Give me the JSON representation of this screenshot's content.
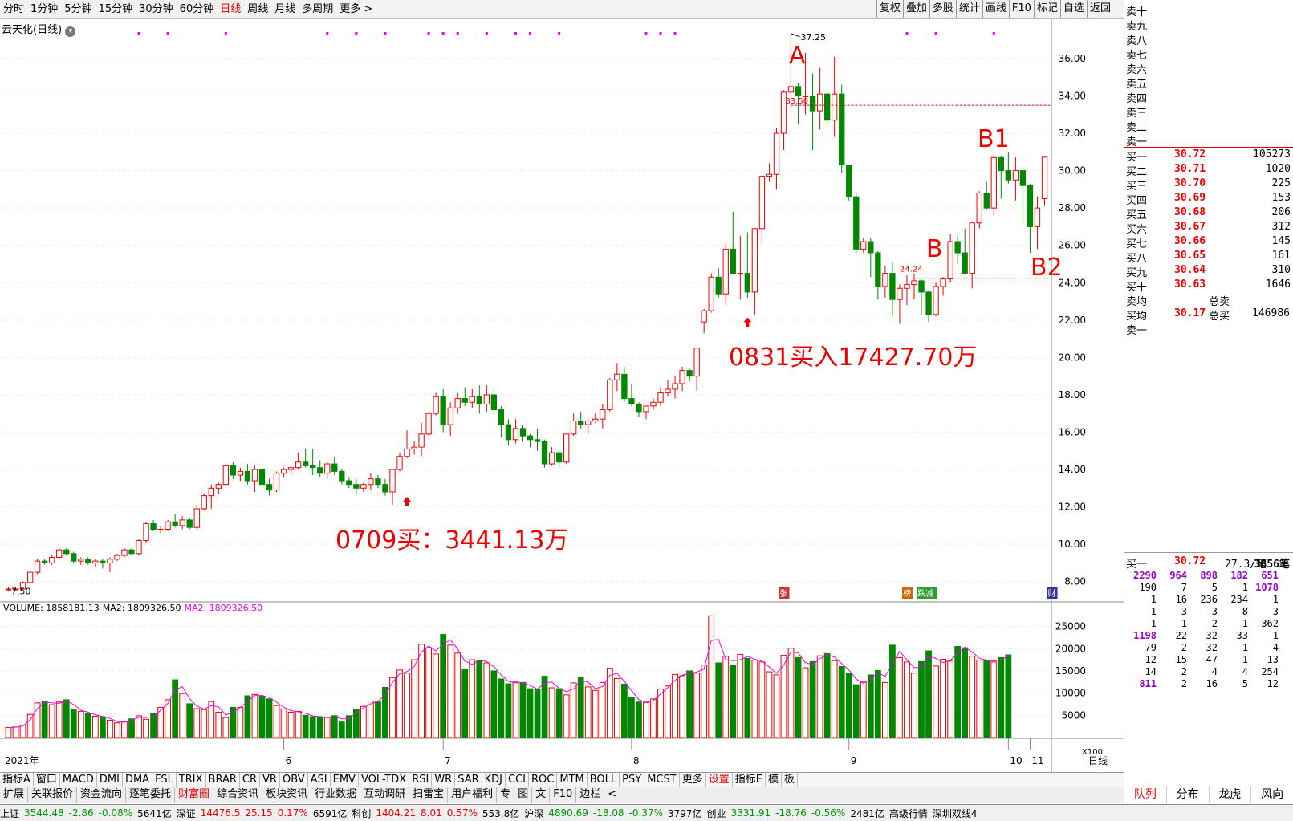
{
  "toolbar": {
    "left": [
      "分时",
      "1分钟",
      "5分钟",
      "15分钟",
      "30分钟",
      "60分钟",
      "日线",
      "周线",
      "月线",
      "多周期",
      "更多 >"
    ],
    "active_index": 6,
    "right": [
      "复权",
      "叠加",
      "多股",
      "统计",
      "画线",
      "F10",
      "标记",
      "自选",
      "返回"
    ]
  },
  "stock_title": "云天化(日线)",
  "annotations": {
    "a": "A",
    "b": "B",
    "b1": "B1",
    "b2": "B2",
    "buy1": "0709买：3441.13万",
    "buy2": "0831买入17427.70万",
    "high": "37.25",
    "low": "7.50",
    "line1": "33.50",
    "line2": "24.24"
  },
  "event_tags": [
    "张",
    "榜",
    "跌减",
    "财"
  ],
  "volume_header": {
    "volume": "VOLUME: 1858181.13",
    "ma2": "MA2: 1809326.50",
    "ma2b": "MA2: 1809326.50"
  },
  "x_labels": [
    "2021年",
    "6",
    "7",
    "8",
    "9",
    "10",
    "11"
  ],
  "period_label": "日线",
  "vol_scale": "X100",
  "sell_levels": [
    "卖十",
    "卖九",
    "卖八",
    "卖七",
    "卖六",
    "卖五",
    "卖四",
    "卖三",
    "卖二",
    "卖一"
  ],
  "buy_levels": [
    {
      "label": "买一",
      "price": "30.72",
      "vol": "105273"
    },
    {
      "label": "买二",
      "price": "30.71",
      "vol": "1020"
    },
    {
      "label": "买三",
      "price": "30.70",
      "vol": "225"
    },
    {
      "label": "买四",
      "price": "30.69",
      "vol": "153"
    },
    {
      "label": "买五",
      "price": "30.68",
      "vol": "206"
    },
    {
      "label": "买六",
      "price": "30.67",
      "vol": "312"
    },
    {
      "label": "买七",
      "price": "30.66",
      "vol": "145"
    },
    {
      "label": "买八",
      "price": "30.65",
      "vol": "161"
    },
    {
      "label": "买九",
      "price": "30.64",
      "vol": "310"
    },
    {
      "label": "买十",
      "price": "30.63",
      "vol": "1646"
    }
  ],
  "averages": {
    "sell_avg": "卖均",
    "total_sell": "总卖",
    "buy_avg": "买均",
    "buy_avg_price": "30.17",
    "total_buy": "总买",
    "total_buy_vol": "146986",
    "sell1": "卖一"
  },
  "queue": {
    "label": "买一",
    "price": "30.72",
    "per": "27.3/笔",
    "count": "3856笔",
    "rows": [
      [
        "2290",
        "964",
        "898",
        "182",
        "651"
      ],
      [
        "190",
        "7",
        "5",
        "1",
        "1078"
      ],
      [
        "1",
        "16",
        "236",
        "234",
        "1"
      ],
      [
        "1",
        "3",
        "3",
        "8",
        "3"
      ],
      [
        "1",
        "1",
        "2",
        "1",
        "362"
      ],
      [
        "1198",
        "22",
        "32",
        "33",
        "1"
      ],
      [
        "79",
        "2",
        "32",
        "1",
        "4"
      ],
      [
        "12",
        "15",
        "47",
        "1",
        "13"
      ],
      [
        "14",
        "2",
        "4",
        "4",
        "254"
      ],
      [
        "811",
        "2",
        "16",
        "5",
        "12"
      ]
    ]
  },
  "bottom_tabs1": [
    "指标A",
    "窗口",
    "MACD",
    "DMI",
    "DMA",
    "FSL",
    "TRIX",
    "BRAR",
    "CR",
    "VR",
    "OBV",
    "ASI",
    "EMV",
    "VOL-TDX",
    "RSI",
    "WR",
    "SAR",
    "KDJ",
    "CCI",
    "ROC",
    "MTM",
    "BOLL",
    "PSY",
    "MCST",
    "更多",
    "设置",
    "指标E",
    "模",
    "板"
  ],
  "bottom_tabs2": [
    "扩展",
    "关联报价",
    "资金流向",
    "逐笔委托",
    "财富圈",
    "综合资讯",
    "板块资讯",
    "行业数据",
    "互动调研",
    "扫雷宝",
    "用户福利",
    "专",
    "图",
    "文",
    "F10",
    "边栏",
    "<"
  ],
  "side_tabs": [
    "队列",
    "分布",
    "龙虎",
    "风向"
  ],
  "status": [
    {
      "name": "上证",
      "v": "3544.48",
      "c": "-2.86",
      "p": "-0.08%",
      "a": "5641亿"
    },
    {
      "name": "深证",
      "v": "14476.5",
      "c": "25.15",
      "p": "0.17%",
      "a": "6591亿"
    },
    {
      "name": "科创",
      "v": "1404.21",
      "c": "8.01",
      "p": "0.57%",
      "a": "553.8亿"
    },
    {
      "name": "沪深",
      "v": "4890.69",
      "c": "-18.08",
      "p": "-0.37%",
      "a": "3797亿"
    },
    {
      "name": "创业",
      "v": "3331.91",
      "c": "-18.76",
      "p": "-0.56%",
      "a": "2481亿"
    }
  ],
  "status_extra": [
    "高级行情",
    "深圳双线4"
  ],
  "chart_data": {
    "type": "candlestick",
    "y_ticks": [
      8,
      10,
      12,
      14,
      16,
      18,
      20,
      22,
      24,
      26,
      28,
      30,
      32,
      34,
      36
    ],
    "ylim": [
      7,
      37.5
    ],
    "vol_ticks": [
      5000,
      10000,
      15000,
      20000,
      25000
    ],
    "vol_lim": [
      0,
      28000
    ],
    "candles": [
      [
        7.6,
        7.7,
        7.5,
        7.6
      ],
      [
        7.6,
        7.7,
        7.55,
        7.6
      ],
      [
        7.6,
        8,
        7.55,
        7.95
      ],
      [
        7.95,
        8.6,
        7.9,
        8.5
      ],
      [
        8.5,
        9.2,
        8.4,
        9.1
      ],
      [
        9.1,
        9.2,
        8.9,
        9
      ],
      [
        9,
        9.4,
        8.9,
        9.3
      ],
      [
        9.3,
        9.8,
        9.2,
        9.7
      ],
      [
        9.7,
        9.8,
        9.4,
        9.5
      ],
      [
        9.5,
        9.6,
        9,
        9.1
      ],
      [
        9.1,
        9.3,
        8.9,
        9.2
      ],
      [
        9.2,
        9.3,
        8.9,
        9
      ],
      [
        9,
        9.2,
        8.8,
        9.1
      ],
      [
        9.1,
        9.2,
        8.7,
        9
      ],
      [
        9,
        9.3,
        8.5,
        9.2
      ],
      [
        9.2,
        9.5,
        9.1,
        9.4
      ],
      [
        9.4,
        9.8,
        9.3,
        9.7
      ],
      [
        9.7,
        9.8,
        9.4,
        9.5
      ],
      [
        9.5,
        10.3,
        9.4,
        10.2
      ],
      [
        10.2,
        11.2,
        10.1,
        11.1
      ],
      [
        11.1,
        11.3,
        10.7,
        10.8
      ],
      [
        10.8,
        11,
        10.6,
        10.8
      ],
      [
        10.8,
        11.3,
        10.7,
        11.2
      ],
      [
        11.2,
        11.6,
        10.9,
        11
      ],
      [
        11,
        11.5,
        10.8,
        11.3
      ],
      [
        11.3,
        11.4,
        10.8,
        10.9
      ],
      [
        10.9,
        12.1,
        10.8,
        11.9
      ],
      [
        11.9,
        12.7,
        11.8,
        12.6
      ],
      [
        12.6,
        13.2,
        11.9,
        13
      ],
      [
        13,
        13.3,
        12.7,
        13.2
      ],
      [
        13.2,
        14.2,
        13.1,
        14.2
      ],
      [
        14.2,
        14.4,
        13.5,
        13.7
      ],
      [
        13.7,
        14.1,
        13.4,
        13.9
      ],
      [
        13.9,
        14.3,
        13.2,
        13.4
      ],
      [
        13.4,
        14.2,
        12.8,
        14
      ],
      [
        14,
        14.1,
        12.9,
        13.2
      ],
      [
        13.2,
        13.5,
        12.6,
        12.9
      ],
      [
        12.9,
        13.9,
        12.8,
        13.8
      ],
      [
        13.8,
        14.1,
        13.6,
        14
      ],
      [
        14,
        14.2,
        13.7,
        14.1
      ],
      [
        14.1,
        14.9,
        14,
        14.4
      ],
      [
        14.4,
        15.1,
        14.1,
        14.2
      ],
      [
        14.2,
        15.1,
        13.7,
        14.1
      ],
      [
        14.1,
        14.5,
        13.6,
        13.8
      ],
      [
        13.8,
        14.4,
        13.5,
        14.3
      ],
      [
        14.3,
        14.7,
        13.7,
        13.9
      ],
      [
        13.9,
        14,
        13.2,
        13.4
      ],
      [
        13.4,
        13.6,
        13,
        13.2
      ],
      [
        13.2,
        13.5,
        12.7,
        13
      ],
      [
        13,
        13.3,
        12.8,
        13.2
      ],
      [
        13.2,
        13.8,
        12.9,
        13.5
      ],
      [
        13.5,
        13.7,
        13,
        13.2
      ],
      [
        13.2,
        13.5,
        12.6,
        12.8
      ],
      [
        12.8,
        14,
        12.1,
        14
      ],
      [
        14,
        14.9,
        13.9,
        14.7
      ],
      [
        14.7,
        16.1,
        14.6,
        15.1
      ],
      [
        15.1,
        15.5,
        14.8,
        15.2
      ],
      [
        15.2,
        16.5,
        14.7,
        15.9
      ],
      [
        15.9,
        17.1,
        15.8,
        17
      ],
      [
        17,
        18.1,
        16.9,
        17.9
      ],
      [
        17.9,
        18.3,
        16,
        16.4
      ],
      [
        16.4,
        17.6,
        15.8,
        17.3
      ],
      [
        17.3,
        18.1,
        17,
        17.8
      ],
      [
        17.8,
        18.4,
        17.4,
        17.6
      ],
      [
        17.6,
        18.3,
        17.3,
        17.9
      ],
      [
        17.9,
        18.5,
        17,
        17.5
      ],
      [
        17.5,
        18.5,
        17.1,
        18
      ],
      [
        18,
        18.3,
        16.9,
        17.2
      ],
      [
        17.2,
        17.4,
        15.7,
        16.4
      ],
      [
        16.4,
        16.7,
        15.3,
        15.6
      ],
      [
        15.6,
        16.7,
        15.4,
        16.2
      ],
      [
        16.2,
        16.4,
        15.5,
        15.8
      ],
      [
        15.8,
        15.9,
        15.2,
        15.6
      ],
      [
        15.6,
        16.2,
        15,
        15.5
      ],
      [
        15.5,
        15.6,
        14.1,
        14.3
      ],
      [
        14.3,
        15.2,
        14.2,
        14.9
      ],
      [
        14.9,
        15,
        14.1,
        14.4
      ],
      [
        14.4,
        15.6,
        14.3,
        15.9
      ],
      [
        15.9,
        17,
        15.8,
        16.6
      ],
      [
        16.6,
        17.1,
        16.2,
        16.4
      ],
      [
        16.4,
        16.7,
        15.9,
        16.6
      ],
      [
        16.6,
        17,
        16.5,
        16.7
      ],
      [
        16.7,
        17.5,
        16.2,
        17.2
      ],
      [
        17.2,
        18.9,
        17.1,
        18.8
      ],
      [
        18.8,
        19.7,
        18.2,
        19.1
      ],
      [
        19.1,
        19.5,
        17.6,
        17.8
      ],
      [
        17.8,
        18.6,
        17.4,
        17.5
      ],
      [
        17.5,
        17.6,
        16.8,
        17.1
      ],
      [
        17.1,
        17.3,
        16.7,
        17.4
      ],
      [
        17.4,
        17.8,
        17.2,
        17.6
      ],
      [
        17.6,
        18.4,
        17.4,
        18.1
      ],
      [
        18.1,
        18.8,
        17.9,
        18.3
      ],
      [
        18.3,
        19,
        17.8,
        18.6
      ],
      [
        18.6,
        19.5,
        18.2,
        19.3
      ],
      [
        19.3,
        19.4,
        18.7,
        19
      ],
      [
        19,
        20.5,
        18.2,
        20.5
      ],
      [
        21.9,
        22.6,
        21.3,
        22.5
      ],
      [
        22.5,
        24.5,
        22.4,
        24.3
      ],
      [
        24.3,
        24.8,
        23.2,
        23.4
      ],
      [
        23.4,
        26.1,
        22.8,
        25.8
      ],
      [
        25.8,
        27.8,
        25.7,
        24.5
      ],
      [
        24.5,
        26.5,
        23.1,
        24.5
      ],
      [
        24.5,
        26.7,
        23.2,
        23.5
      ],
      [
        23.5,
        26.9,
        22.3,
        26.9
      ],
      [
        26.9,
        29.8,
        26.1,
        29.7
      ],
      [
        29.7,
        30.4,
        29.4,
        29.8
      ],
      [
        29.8,
        32.3,
        29,
        32
      ],
      [
        32,
        34.3,
        31.1,
        34.2
      ],
      [
        34.2,
        37.25,
        33.2,
        34.5
      ],
      [
        34.5,
        34.7,
        32.5,
        34
      ],
      [
        34,
        36.3,
        33,
        34
      ],
      [
        34,
        35.2,
        31.1,
        33.2
      ],
      [
        33.2,
        35.5,
        32.2,
        34.1
      ],
      [
        34.1,
        34.2,
        32.5,
        32.7
      ],
      [
        32.7,
        36.1,
        31.8,
        34.1
      ],
      [
        34.1,
        34.6,
        29.9,
        30.3
      ],
      [
        30.3,
        30.3,
        28.4,
        28.6
      ],
      [
        28.6,
        28.8,
        25.6,
        25.8
      ],
      [
        25.8,
        26.4,
        25.6,
        26.2
      ],
      [
        26.2,
        26.4,
        24.3,
        25.6
      ],
      [
        25.6,
        25.7,
        23.1,
        23.8
      ],
      [
        23.8,
        24.9,
        23.2,
        24.5
      ],
      [
        24.5,
        25.1,
        22.2,
        23.1
      ],
      [
        23.1,
        23.9,
        21.8,
        23.7
      ],
      [
        23.7,
        24.4,
        22.8,
        23.9
      ],
      [
        23.9,
        24.5,
        23.1,
        24.1
      ],
      [
        24.1,
        24.2,
        22.3,
        23.5
      ],
      [
        23.5,
        23.6,
        21.9,
        22.3
      ],
      [
        22.3,
        24,
        22.2,
        23.8
      ],
      [
        23.8,
        24.3,
        23.3,
        24.2
      ],
      [
        24.2,
        26.6,
        24,
        26.2
      ],
      [
        26.2,
        26.5,
        25,
        25.6
      ],
      [
        25.6,
        26.9,
        24.8,
        24.5
      ],
      [
        24.5,
        27.2,
        23.7,
        27.2
      ],
      [
        27.2,
        28.9,
        26.9,
        28.8
      ],
      [
        28.8,
        29.4,
        27.9,
        28
      ],
      [
        28,
        30.8,
        27.6,
        30.7
      ],
      [
        30.7,
        30.8,
        28.5,
        30
      ],
      [
        30,
        31,
        29.3,
        29.5
      ],
      [
        29.5,
        30.7,
        28.4,
        30
      ],
      [
        30,
        30.2,
        27.1,
        29.2
      ],
      [
        29.2,
        29.3,
        25.6,
        27
      ],
      [
        27,
        28.6,
        25.8,
        28
      ],
      [
        28.5,
        30.72,
        28.1,
        30.72
      ]
    ],
    "volumes": [
      2250,
      2380,
      2800,
      5200,
      7800,
      8200,
      7400,
      8000,
      8500,
      6400,
      5900,
      5500,
      4800,
      4700,
      3900,
      3300,
      3500,
      4200,
      4900,
      4100,
      5400,
      6800,
      8500,
      13000,
      9900,
      7600,
      6500,
      6300,
      8100,
      5700,
      4500,
      6800,
      6800,
      9400,
      9700,
      9300,
      8700,
      7200,
      6400,
      5700,
      5900,
      5000,
      4700,
      4700,
      4500,
      4900,
      3500,
      4900,
      6400,
      7000,
      8200,
      8000,
      11300,
      13500,
      15200,
      14500,
      17500,
      21000,
      20200,
      18800,
      23200,
      20800,
      19000,
      15400,
      17500,
      17400,
      16800,
      15000,
      13200,
      12100,
      12500,
      12400,
      11000,
      10800,
      13800,
      11200,
      11000,
      9600,
      12300,
      13500,
      11400,
      10600,
      12400,
      15600,
      13300,
      12000,
      9100,
      8000,
      7900,
      8700,
      10900,
      11600,
      14200,
      13900,
      15000,
      14500,
      16300,
      27400,
      16800,
      18300,
      16300,
      18700,
      17800,
      17400,
      17000,
      14800,
      14100,
      18500,
      20100,
      18000,
      15700,
      17100,
      18400,
      18900,
      17300,
      16000,
      14400,
      11900,
      12500,
      14100,
      15100,
      12400,
      20800,
      18000,
      17000,
      14500,
      17100,
      19500,
      16100,
      17600,
      17200,
      20500,
      20200,
      18300,
      17400,
      17400,
      17000,
      18000,
      18600
    ],
    "ma_line": "MA2"
  }
}
